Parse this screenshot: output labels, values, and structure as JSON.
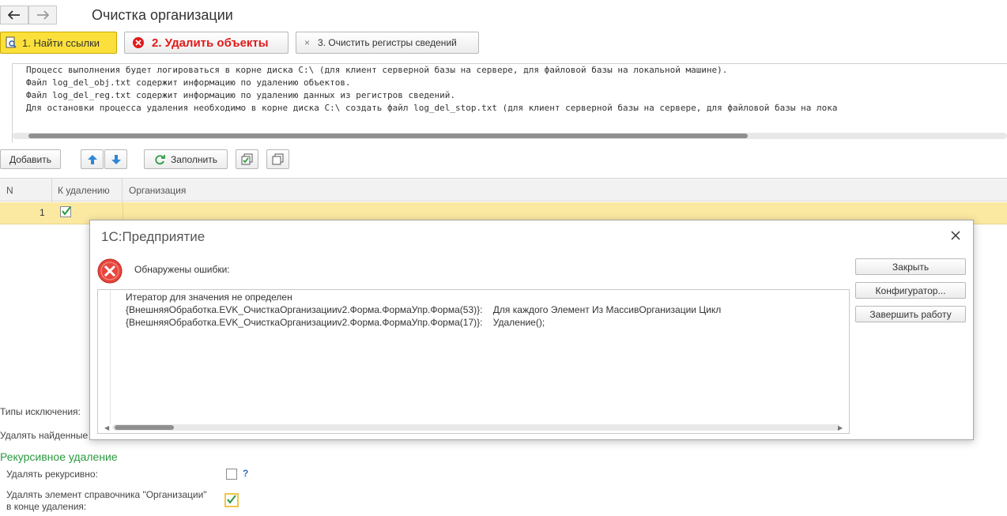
{
  "header": {
    "title": "Очистка организации"
  },
  "actions": {
    "find_links": "1. Найти ссылки",
    "delete_objects": "2. Удалить объекты",
    "clear_registers": "3. Очистить регистры сведений",
    "clear_registers_icon": "×"
  },
  "log": {
    "lines": [
      "Процесс выполнения будет логироваться в корне диска C:\\ (для клиент серверной базы на сервере, для файловой базы на локальной машине).",
      "Файл log_del_obj.txt содержит информацию по удалению объектов.",
      "Файл log_del_reg.txt содержит информацию по удалению данных из регистров сведений.",
      "Для остановки процесса удаления необходимо в корне диска C:\\ создать файл log_del_stop.txt (для клиент серверной базы на сервере, для файловой базы на лока"
    ]
  },
  "toolbar": {
    "add": "Добавить",
    "fill": "Заполнить"
  },
  "table": {
    "columns": [
      "N",
      "К удалению",
      "Организация"
    ],
    "rows": [
      {
        "n": "1",
        "to_delete": true,
        "organization": ""
      }
    ]
  },
  "dialog": {
    "title": "1С:Предприятие",
    "message": "Обнаружены ошибки:",
    "error_lines": [
      "Итератор для значения не определен",
      "{ВнешняяОбработка.EVK_ОчисткаОрганизацииv2.Форма.ФормаУпр.Форма(53)}:    Для каждого Элемент Из МассивОрганизации Цикл",
      "{ВнешняяОбработка.EVK_ОчисткаОрганизацииv2.Форма.ФормаУпр.Форма(17)}:    Удаление();"
    ],
    "buttons": {
      "close": "Закрыть",
      "configurator": "Конфигуратор...",
      "terminate": "Завершить работу"
    }
  },
  "settings": {
    "exclusion_types_label": "Типы исключения:",
    "delete_found_label": "Удалять найденные",
    "recursive_section": "Рекурсивное удаление",
    "delete_recursive_label": "Удалять рекурсивно:",
    "delete_recursive_checked": false,
    "help_mark": "?",
    "delete_element_label_1": "Удалять элемент справочника \"Организации\"",
    "delete_element_label_2": "в конце удаления:",
    "delete_element_checked": true
  },
  "colors": {
    "accent_yellow": "#fbe03b",
    "error_red": "#e21a1a",
    "section_green": "#2a9a3f",
    "selected_row": "#fbe9a2"
  }
}
